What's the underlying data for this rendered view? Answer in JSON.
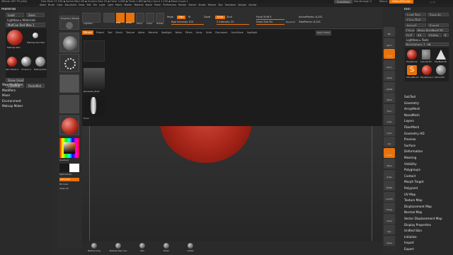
{
  "title_bar": {
    "app": "ZBrush 4R7 P3 (x64)",
    "stats": "Free Mem 27.538 ▪ Active Mem 65 ▪ Scratch Disk 25 ▪ Timer 1.685 ▪ Timer 1.683 ▪ Poly Count 1.235 ▪ Mesh Count 1",
    "menus": [
      "Alpha",
      "Brush",
      "Color",
      "Document",
      "Draw",
      "Edit",
      "File",
      "Layer",
      "Light",
      "Macro",
      "Marker",
      "Material",
      "Movie",
      "Picker",
      "Preferences",
      "Render",
      "Stencil",
      "Stroke",
      "Texture",
      "Tool",
      "Transform",
      "Zplugin",
      "Zscript"
    ],
    "quicksave": "QuickSave",
    "seethrough": "See-through 0",
    "menus_label": "Menus",
    "script_label": "DefaultZScript"
  },
  "left_header": {
    "title": "Material",
    "load": "Load",
    "save": "Save",
    "lightbox_materials": "Lightbox ▸ Materials",
    "matcap_label": "MatCap Red Wax 1",
    "show_used": "Show Used",
    "copymat": "CopyMat",
    "pastemat": "PasteMat"
  },
  "left_menu": [
    "Wax Modifiers",
    "Modifiers",
    "Mixer",
    "Environment",
    "Matcap Maker"
  ],
  "materials": [
    "MatCap Wax",
    "MatCap Red Wax",
    "Skin Shade 4",
    "Chrome A",
    "Basic Material",
    "MatCap Pearl Cav"
  ],
  "toolbar": {
    "projection_master": "Projection Master",
    "lightbox": "LightBox",
    "quick_sketch": "Quick Sketch",
    "edit": "Edit",
    "draw": "Draw",
    "move": "Move",
    "scale": "Scale",
    "rotate": "Rotate",
    "mrgb": "Mrgb",
    "rgb": "Rgb",
    "m": "M",
    "rgb_intensity": "Rgb Intensity 100",
    "zadd": "Zadd",
    "zsub": "Zsub",
    "zcut": "Zcut",
    "z_intensity": "Z Intensity 25",
    "focal_shift": "Focal Shift 0",
    "draw_size": "Draw Size 64",
    "dynamic": "Dynamic",
    "active_points": "ActivePoints: 8,241",
    "total_points": "TotalPoints: 8,241"
  },
  "lightbox": {
    "tabs": [
      "ZBrush",
      "Project",
      "Tool",
      "Brush",
      "Texture",
      "Alpha",
      "Material",
      "Spotlight",
      "Noise",
      "Filters",
      "Array",
      "Grids",
      "Document",
      "QuickSave",
      "Spotlight"
    ],
    "open_folder": "Open Folder",
    "items": [
      "Recessed_Bust",
      "DecimationMaster",
      "DecoratedFrame",
      "Torso"
    ]
  },
  "palette": {
    "brushes": [
      "Standard",
      "Clay Buildup",
      "Move",
      "DamStandard"
    ],
    "strokes": [
      "DragRect"
    ],
    "alpha": "Alpha Off",
    "texture": "Texture Off",
    "material": "MatCap Red Wax",
    "gradient": "Gradient",
    "switch_color": "SwitchColor",
    "alternate": "Alternate",
    "fill_color": "Fill Color",
    "clear_all": "Clear All"
  },
  "bottom_shelf": [
    "MatCap Gray",
    "MatCap Pearl Cav",
    "Ball",
    "Polish",
    "Inflate"
  ],
  "right_tools": [
    "Bpr",
    "Spix 3",
    "Scroll",
    "Zoom",
    "Actual",
    "AAHalf",
    "Persp",
    "Floor",
    "Local",
    "L.Sym",
    "Xyz",
    "Frame",
    "Move",
    "Scale",
    "Rotate",
    "Line Fill",
    "Transp",
    "Ghost",
    "Solo",
    "Xpose"
  ],
  "right_header": {
    "title": "Tool",
    "load": "Load Tool",
    "save_as": "Save As",
    "copy_tool": "Copy Tool",
    "paste_tool": "Paste Tool",
    "import": "Import",
    "export": "Export",
    "clone": "Clone",
    "make_polymesh": "Make PolyMesh3D",
    "goz": "GoZ",
    "all": "All",
    "visible": "Visible",
    "r": "R",
    "lightbox_tools": "Lightbox ▸ Tools",
    "polysphere": "PolySphere_1. 48",
    "tools": [
      "PolySphere",
      "Cylinder3D",
      "PolyMesh3D",
      "SimpleBrush",
      "PolySphere_1",
      "Sphere3D"
    ]
  },
  "right_menu": [
    "SubTool",
    "Geometry",
    "ArrayMesh",
    "NanoMesh",
    "Layers",
    "FiberMesh",
    "Geometry HD",
    "Preview",
    "Surface",
    "Deformation",
    "Masking",
    "Visibility",
    "Polygroups",
    "Contact",
    "Morph Target",
    "Polypaint",
    "UV Map",
    "Texture Map",
    "Displacement Map",
    "Normal Map",
    "Vector Displacement Map",
    "Display Properties",
    "Unified Skin",
    "Initialize",
    "Import",
    "Export"
  ],
  "colors": {
    "accent": "#e8720c",
    "panel": "#2b2b2b",
    "section": "#3a3a3a",
    "wax": "#b8291e"
  }
}
